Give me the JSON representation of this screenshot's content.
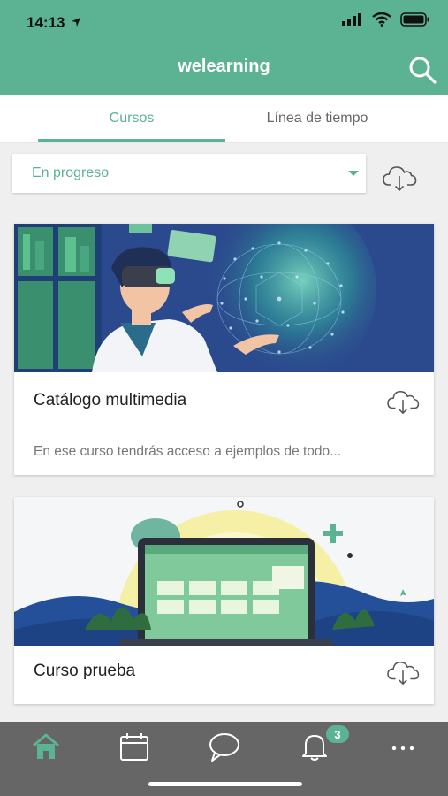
{
  "status": {
    "time": "14:13"
  },
  "header": {
    "title": "welearning"
  },
  "tabs": [
    {
      "label": "Cursos",
      "active": true
    },
    {
      "label": "Línea de tiempo",
      "active": false
    }
  ],
  "filter": {
    "selected": "En progreso"
  },
  "courses": [
    {
      "title": "Catálogo multimedia",
      "description": "En ese curso tendrás acceso a ejemplos de todo..."
    },
    {
      "title": "Curso prueba",
      "description": ""
    }
  ],
  "nav": {
    "badge_count": "3"
  },
  "colors": {
    "accent": "#5bb393",
    "nav_bg": "#666666",
    "page_bg": "#efefef"
  },
  "icons": [
    "navigation-arrow-icon",
    "signal-icon",
    "wifi-icon",
    "battery-icon",
    "search-icon",
    "dropdown-caret-icon",
    "cloud-download-icon",
    "home-icon",
    "calendar-icon",
    "chat-icon",
    "bell-icon",
    "more-icon"
  ]
}
